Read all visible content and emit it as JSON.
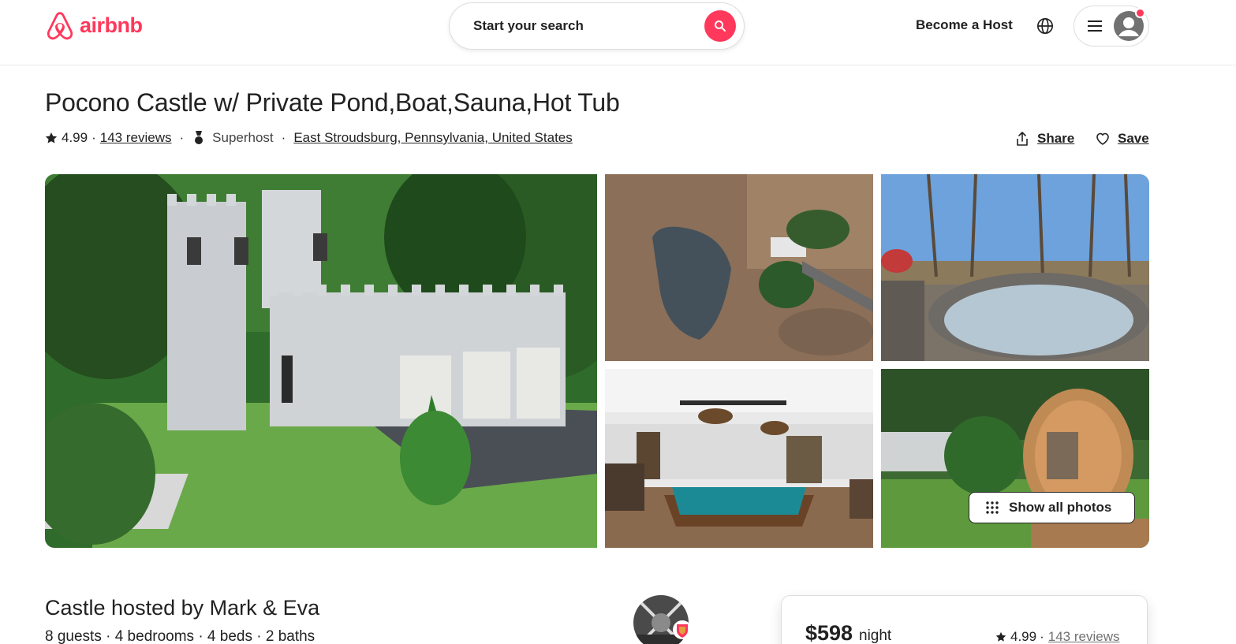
{
  "brand": {
    "name": "airbnb",
    "color": "#FF385C"
  },
  "header": {
    "search_label": "Start your search",
    "become_host": "Become a Host",
    "icons": [
      "search-icon",
      "globe-icon",
      "menu-icon",
      "user-avatar-icon"
    ]
  },
  "listing": {
    "title": "Pocono Castle w/ Private Pond,Boat,Sauna,Hot Tub",
    "rating": "4.99",
    "rating_sep": "·",
    "reviews": "143 reviews",
    "dot": "·",
    "superhost": "Superhost",
    "location": "East Stroudsburg, Pennsylvania, United States",
    "share_label": "Share",
    "save_label": "Save"
  },
  "photos": {
    "show_all_label": "Show all photos"
  },
  "host": {
    "heading": "Castle hosted by Mark & Eva",
    "details": "8 guests · 4 bedrooms · 4 beds · 2 baths"
  },
  "booking": {
    "price": "$598",
    "per": "night",
    "rating": "4.99",
    "rating_sep": "·",
    "reviews": "143 reviews"
  }
}
